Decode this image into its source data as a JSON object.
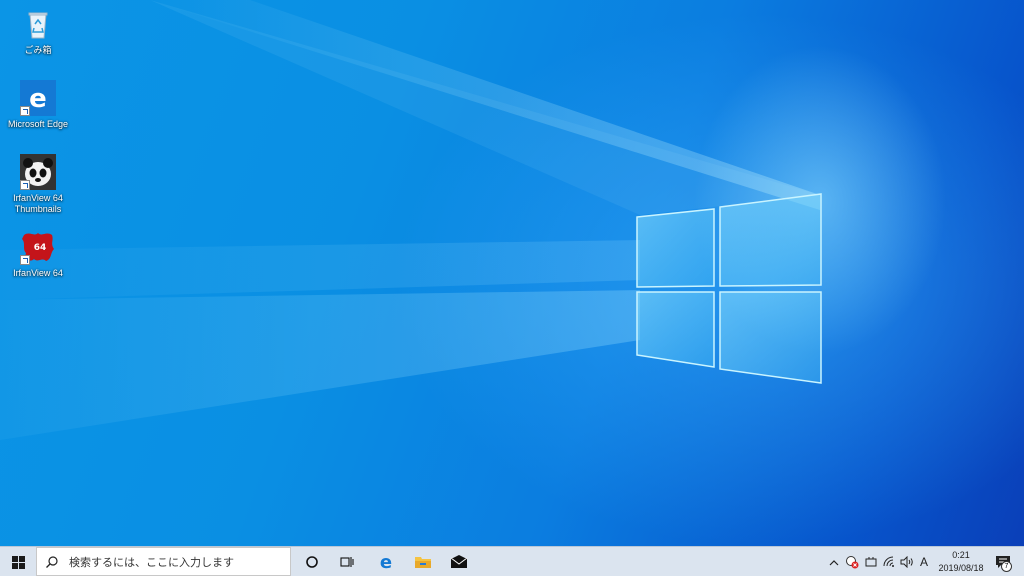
{
  "desktop": {
    "icons": [
      {
        "label": "ごみ箱",
        "icon": "recycle-bin-icon"
      },
      {
        "label": "Microsoft Edge",
        "icon": "edge-icon"
      },
      {
        "label": "IrfanView 64\nThumbnails",
        "icon": "irfanview-thumbnails-icon"
      },
      {
        "label": "IrfanView 64",
        "icon": "irfanview-icon"
      }
    ],
    "irfanview_badge": "64"
  },
  "taskbar": {
    "search_placeholder": "検索するには、ここに入力します",
    "pinned": [
      "cortana-icon",
      "task-view-icon",
      "edge-icon",
      "file-explorer-icon",
      "mail-icon"
    ],
    "tray": {
      "ime_mode": "A",
      "time": "0:21",
      "date": "2019/08/18",
      "notification_count": "7"
    }
  },
  "colors": {
    "accent": "#0078d7",
    "taskbar_bg": "#dbe4ef"
  }
}
